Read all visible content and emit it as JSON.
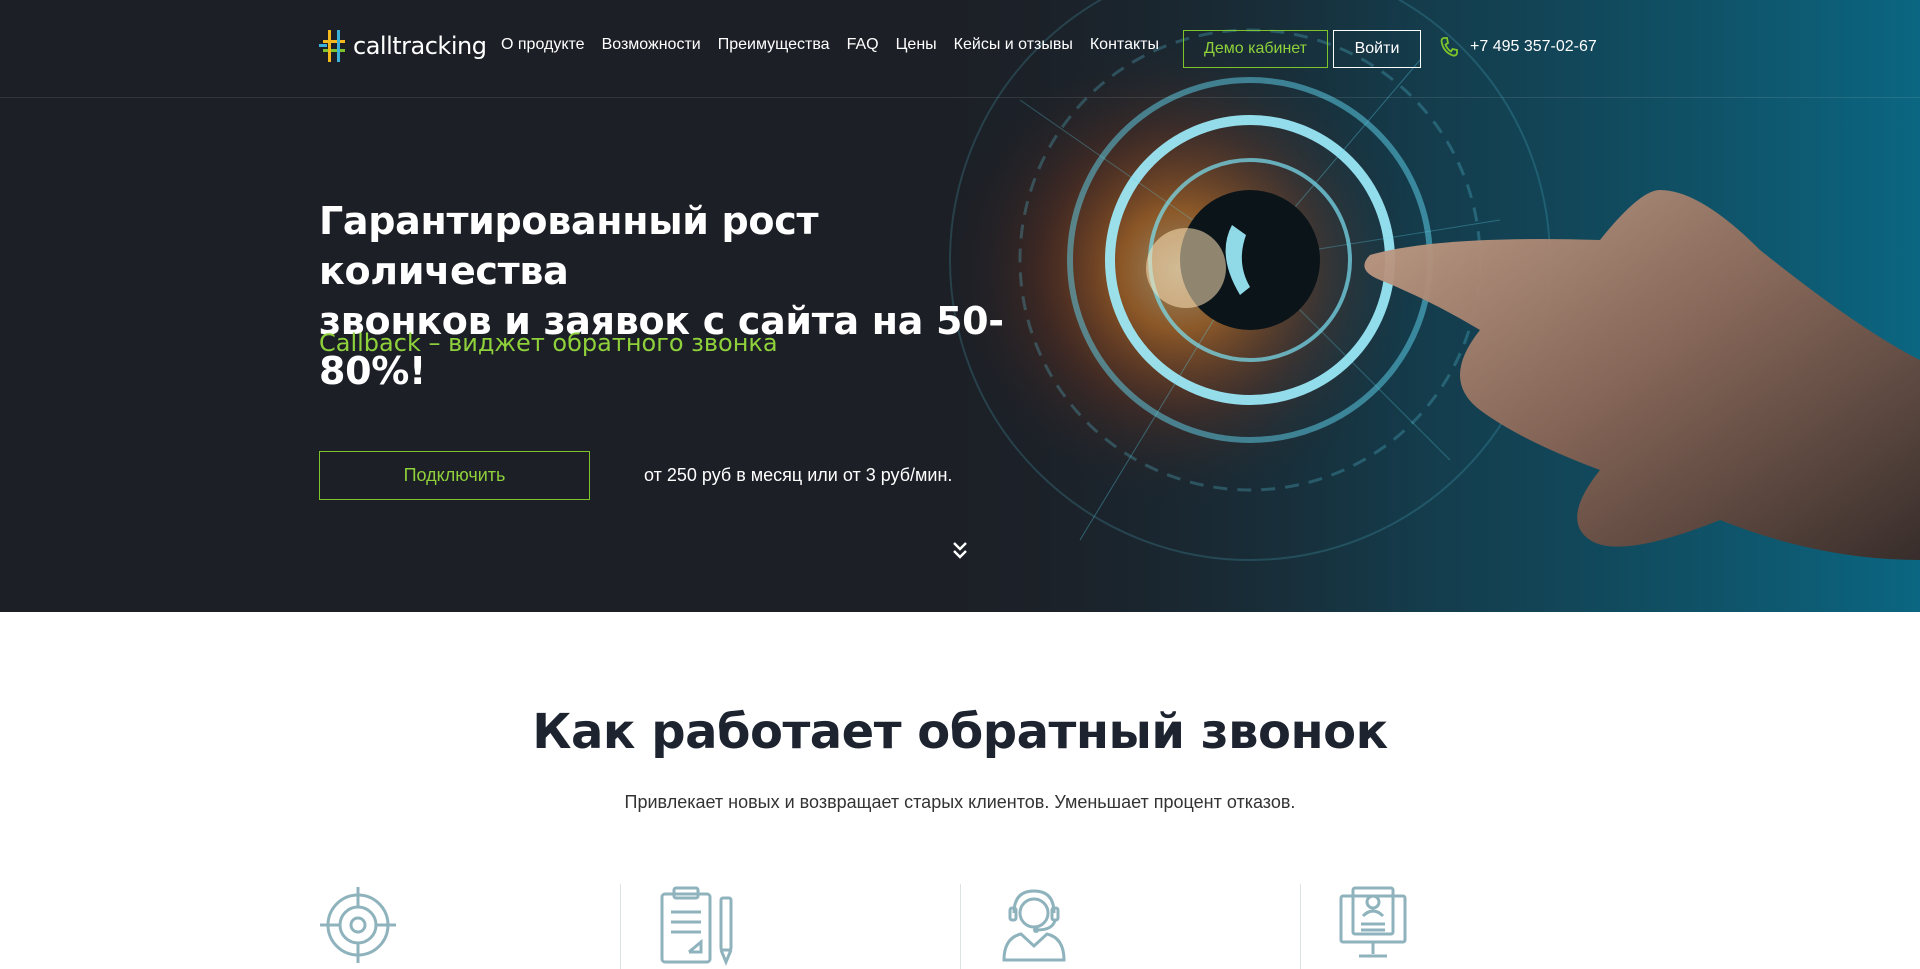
{
  "header": {
    "logo_text": "calltracking",
    "nav": [
      "О продукте",
      "Возможности",
      "Преимущества",
      "FAQ",
      "Цены",
      "Кейсы и отзывы",
      "Контакты"
    ],
    "demo_label": "Демо кабинет",
    "login_label": "Войти",
    "phone": "+7 495 357-02-67"
  },
  "hero": {
    "title_line1": "Гарантированный рост количества",
    "title_line2": "звонков и заявок с сайта на 50-80%!",
    "subtitle": "Callback – виджет обратного звонка",
    "connect_label": "Подключить",
    "price": "от 250 руб в месяц или от 3 руб/мин."
  },
  "how": {
    "title": "Как работает обратный звонок",
    "subtitle": "Привлекает новых и возвращает старых клиентов. Уменьшает процент отказов.",
    "icons": [
      "target-icon",
      "clipboard-pen-icon",
      "operator-headset-icon",
      "monitor-profile-icon"
    ]
  },
  "colors": {
    "accent": "#8ed13a",
    "hero_bg": "#1c1f26",
    "icon": "#8fb3bd",
    "title_dark": "#1d2430"
  }
}
